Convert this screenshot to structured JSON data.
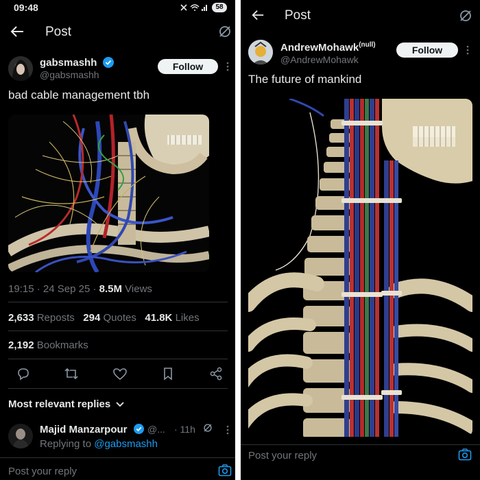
{
  "left": {
    "status_bar": {
      "time": "09:48",
      "battery": "58"
    },
    "header": {
      "title": "Post"
    },
    "author": {
      "display_name": "gabsmashh",
      "handle": "@gabsmashh",
      "follow_label": "Follow"
    },
    "post_text": "bad cable management tbh",
    "meta": {
      "time": "19:15",
      "date": "24 Sep 25",
      "views_count": "8.5M",
      "views_label": "Views"
    },
    "stats": {
      "reposts_count": "2,633",
      "reposts_label": "Reposts",
      "quotes_count": "294",
      "quotes_label": "Quotes",
      "likes_count": "41.8K",
      "likes_label": "Likes",
      "bookmarks_count": "2,192",
      "bookmarks_label": "Bookmarks"
    },
    "replies_sort_label": "Most relevant replies",
    "reply": {
      "display_name": "Majid Manzarpour",
      "handle": "@...",
      "age": "· 11h",
      "replying_prefix": "Replying to",
      "replying_to": "@gabsmashh"
    },
    "composer_placeholder": "Post your reply"
  },
  "right": {
    "header": {
      "title": "Post"
    },
    "author": {
      "display_name": "AndrewMohawk",
      "superscript": "(null)",
      "handle": "@AndrewMohawk",
      "follow_label": "Follow"
    },
    "post_text": "The future of mankind",
    "composer_placeholder": "Post your reply"
  },
  "colors": {
    "accent": "#1d9bf0",
    "background": "#000000",
    "text": "#e7e9ea",
    "muted": "#71767b",
    "divider": "#2f3336"
  }
}
